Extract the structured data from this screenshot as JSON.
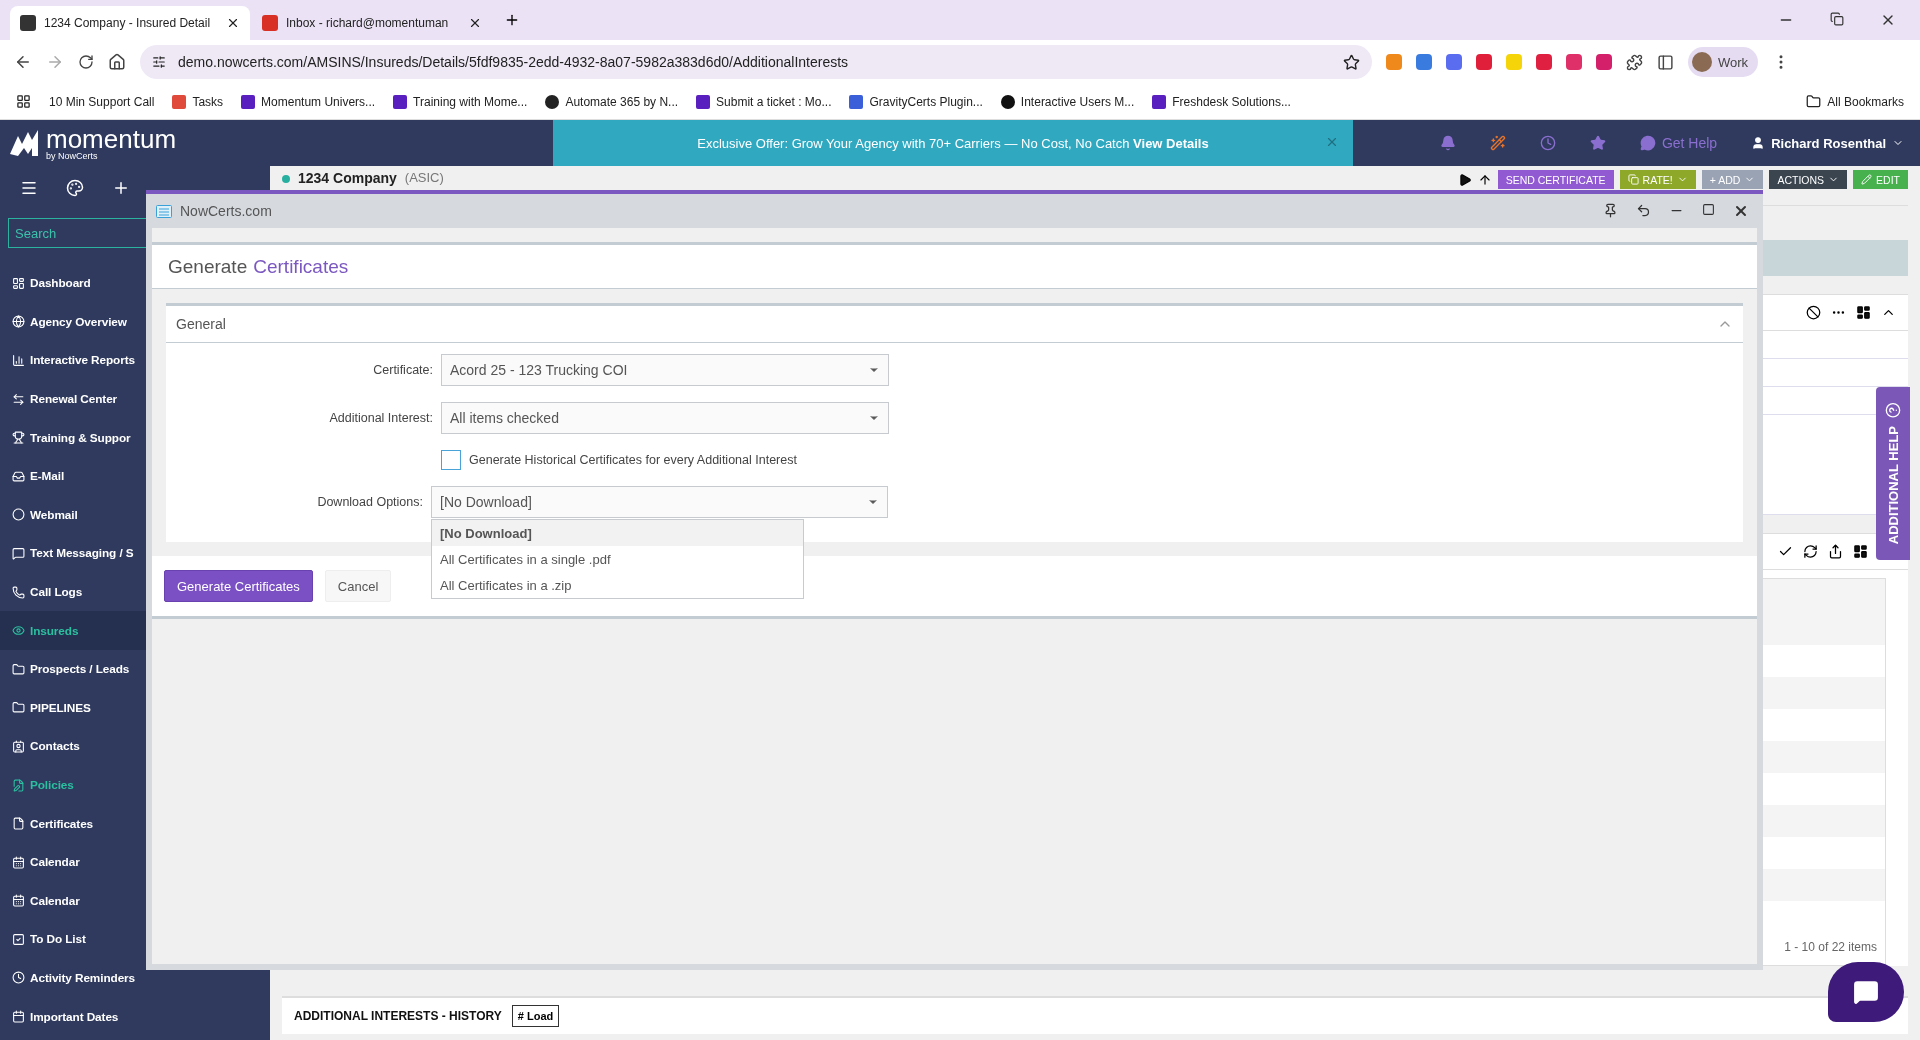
{
  "browser": {
    "tabs": [
      {
        "title": "1234 Company - Insured Detail",
        "selected": true
      },
      {
        "title": "Inbox - richard@momentuman",
        "selected": false
      }
    ],
    "url": "demo.nowcerts.com/AMSINS/Insureds/Details/5fdf9835-2edd-4932-8a07-5982a383d6d0/AdditionalInterests",
    "profile": "Work",
    "bookmarks": [
      "10 Min Support Call",
      "Tasks",
      "Momentum Univers...",
      "Training with Mome...",
      "Automate 365 by N...",
      "Submit a ticket : Mo...",
      "GravityCerts Plugin...",
      "Interactive Users M...",
      "Freshdesk Solutions..."
    ],
    "all_bookmarks": "All Bookmarks"
  },
  "header": {
    "logo": "momentum",
    "logo_sub": "by NowCerts",
    "banner": "Exclusive Offer: Grow Your Agency with 70+ Carriers — No Cost, No Catch **View Details**",
    "help": "Get Help",
    "user": "Richard Rosenthal"
  },
  "sidebar": {
    "search_placeholder": "Search",
    "items": [
      {
        "label": "Dashboard",
        "selected": false,
        "highlighted": false
      },
      {
        "label": "Agency Overview",
        "selected": false,
        "highlighted": false
      },
      {
        "label": "Interactive Reports",
        "selected": false,
        "highlighted": false
      },
      {
        "label": "Renewal Center",
        "selected": false,
        "highlighted": false
      },
      {
        "label": "Training & Suppor",
        "selected": false,
        "highlighted": false
      },
      {
        "label": "E-Mail",
        "selected": false,
        "highlighted": false
      },
      {
        "label": "Webmail",
        "selected": false,
        "highlighted": false
      },
      {
        "label": "Text Messaging / S",
        "selected": false,
        "highlighted": false
      },
      {
        "label": "Call Logs",
        "selected": false,
        "highlighted": false
      },
      {
        "label": "Insureds",
        "selected": true,
        "highlighted": true
      },
      {
        "label": "Prospects / Leads",
        "selected": false,
        "highlighted": false
      },
      {
        "label": "PIPELINES",
        "selected": false,
        "highlighted": false
      },
      {
        "label": "Contacts",
        "selected": false,
        "highlighted": false
      },
      {
        "label": "Policies",
        "selected": false,
        "highlighted": true
      },
      {
        "label": "Certificates",
        "selected": false,
        "highlighted": false
      },
      {
        "label": "Calendar",
        "selected": false,
        "highlighted": false
      },
      {
        "label": "Calendar",
        "selected": false,
        "highlighted": false
      },
      {
        "label": "To Do List",
        "selected": false,
        "highlighted": false
      },
      {
        "label": "Activity Reminders",
        "selected": false,
        "highlighted": false
      },
      {
        "label": "Important Dates",
        "selected": false,
        "highlighted": false
      }
    ]
  },
  "page": {
    "title": "1234 Company",
    "subtitle": "(ASIC)",
    "actions": [
      {
        "label": "SEND CERTIFICATE",
        "kind": "purple",
        "menu": false
      },
      {
        "label": "RATE!",
        "kind": "olive",
        "menu": true
      },
      {
        "label": "+ ADD",
        "kind": "grey",
        "menu": true
      },
      {
        "label": "ACTIONS",
        "kind": "dark",
        "menu": true
      },
      {
        "label": "EDIT",
        "kind": "green",
        "menu": false
      }
    ],
    "pagination": "1 - 10 of 22 items",
    "history_title": "ADDITIONAL INTERESTS - HISTORY",
    "load_button": "# Load",
    "help_tab": "ADDITIONAL HELP"
  },
  "dialog": {
    "window_title": "NowCerts.com",
    "heading": "Generate",
    "heading_accent": "Certificates",
    "section": {
      "title": "General",
      "expanded": true
    },
    "fields": [
      {
        "label": "Certificate:",
        "value": "Acord 25 - 123 Trucking COI"
      },
      {
        "label": "Additional Interest:",
        "value": "All items checked"
      }
    ],
    "checkbox": {
      "label": "Generate Historical Certificates for every Additional Interest",
      "checked": false
    },
    "download": {
      "label": "Download Options:",
      "value": "[No Download]",
      "open": true,
      "options": [
        {
          "label": "[No Download]",
          "selected": true
        },
        {
          "label": "All Certificates in a single .pdf",
          "selected": false
        },
        {
          "label": "All Certificates in a .zip",
          "selected": false
        }
      ]
    },
    "buttons": [
      {
        "label": "Generate Certificates",
        "kind": "primary"
      },
      {
        "label": "Cancel",
        "kind": "default"
      }
    ]
  }
}
